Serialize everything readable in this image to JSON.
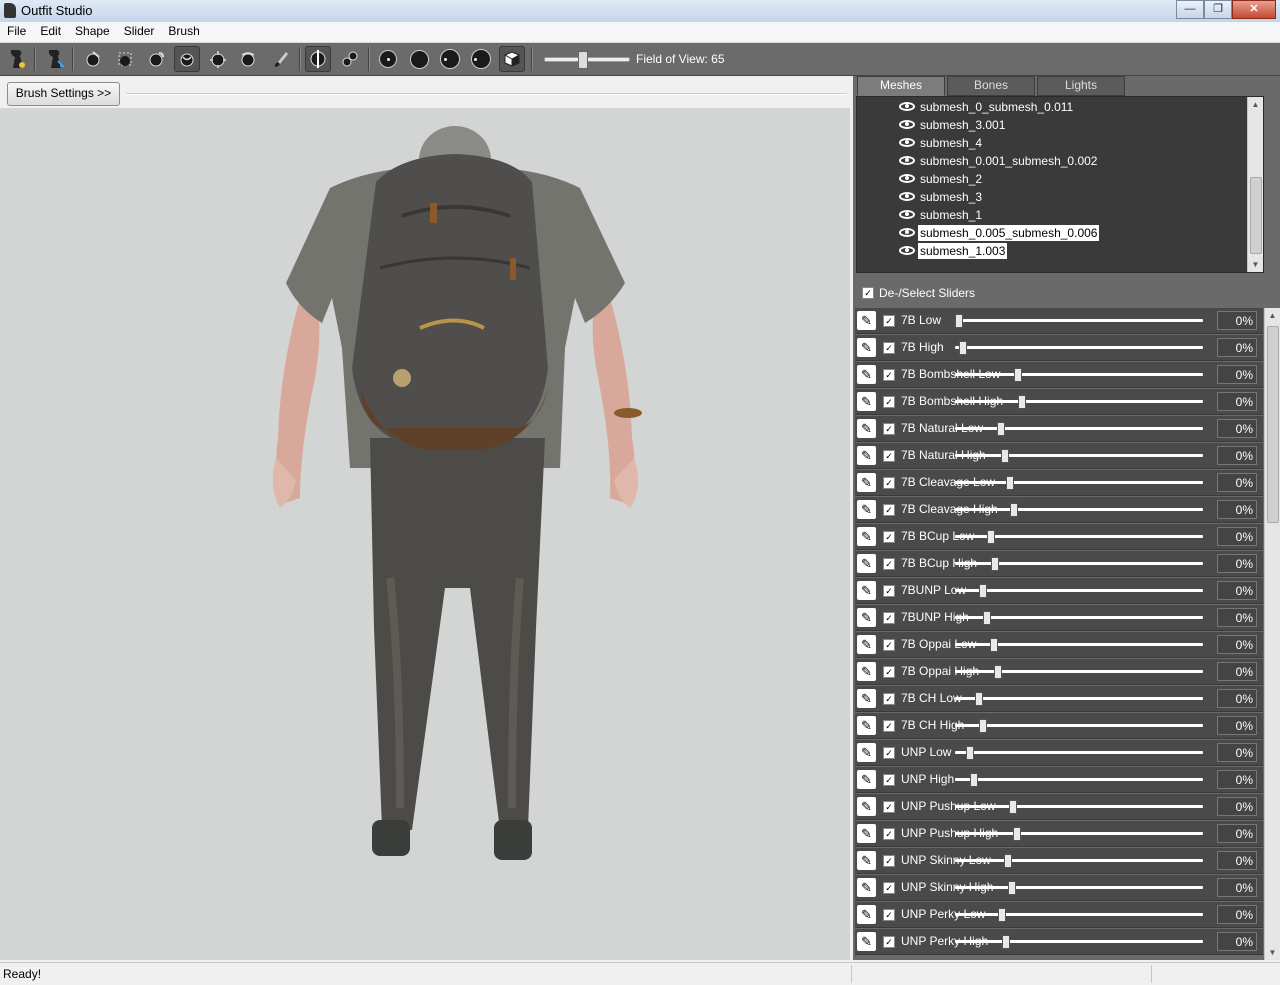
{
  "window": {
    "title": "Outfit Studio"
  },
  "menu": [
    "File",
    "Edit",
    "Shape",
    "Slider",
    "Brush"
  ],
  "toolbar": {
    "fov_label": "Field of View: 65",
    "fov_value": 65
  },
  "brush_settings_label": "Brush Settings >>",
  "tabs": [
    {
      "label": "Meshes",
      "active": true
    },
    {
      "label": "Bones",
      "active": false
    },
    {
      "label": "Lights",
      "active": false
    }
  ],
  "meshes": [
    {
      "name": "submesh_0_submesh_0.011",
      "selected": false
    },
    {
      "name": "submesh_3.001",
      "selected": false
    },
    {
      "name": "submesh_4",
      "selected": false
    },
    {
      "name": "submesh_0.001_submesh_0.002",
      "selected": false
    },
    {
      "name": "submesh_2",
      "selected": false
    },
    {
      "name": "submesh_3",
      "selected": false
    },
    {
      "name": "submesh_1",
      "selected": false
    },
    {
      "name": "submesh_0.005_submesh_0.006",
      "selected": true
    },
    {
      "name": "submesh_1.003",
      "selected": true
    }
  ],
  "deselect_label": "De-/Select Sliders",
  "sliders": [
    {
      "name": "7B Low",
      "value": "0%",
      "level": 0
    },
    {
      "name": "7B High",
      "value": "0%",
      "level": 0
    },
    {
      "name": "7B Bombshell Low",
      "value": "0%",
      "level": 0
    },
    {
      "name": "7B Bombshell High",
      "value": "0%",
      "level": 0
    },
    {
      "name": "7B Natural Low",
      "value": "0%",
      "level": 0
    },
    {
      "name": "7B Natural High",
      "value": "0%",
      "level": 0
    },
    {
      "name": "7B Cleavage Low",
      "value": "0%",
      "level": 0
    },
    {
      "name": "7B Cleavage High",
      "value": "0%",
      "level": 0
    },
    {
      "name": "7B BCup Low",
      "value": "0%",
      "level": 0
    },
    {
      "name": "7B BCup High",
      "value": "0%",
      "level": 0
    },
    {
      "name": "7BUNP Low",
      "value": "0%",
      "level": 0
    },
    {
      "name": "7BUNP High",
      "value": "0%",
      "level": 0
    },
    {
      "name": "7B Oppai Low",
      "value": "0%",
      "level": 0
    },
    {
      "name": "7B Oppai High",
      "value": "0%",
      "level": 0
    },
    {
      "name": "7B CH Low",
      "value": "0%",
      "level": 0
    },
    {
      "name": "7B CH High",
      "value": "0%",
      "level": 0
    },
    {
      "name": "UNP Low",
      "value": "0%",
      "level": 0
    },
    {
      "name": "UNP High",
      "value": "0%",
      "level": 0
    },
    {
      "name": "UNP Pushup Low",
      "value": "0%",
      "level": 0
    },
    {
      "name": "UNP Pushup High",
      "value": "0%",
      "level": 0
    },
    {
      "name": "UNP Skinny Low",
      "value": "0%",
      "level": 0
    },
    {
      "name": "UNP Skinny High",
      "value": "0%",
      "level": 0
    },
    {
      "name": "UNP Perky Low",
      "value": "0%",
      "level": 0
    },
    {
      "name": "UNP Perky High",
      "value": "0%",
      "level": 0
    }
  ],
  "status": {
    "text": "Ready!"
  }
}
